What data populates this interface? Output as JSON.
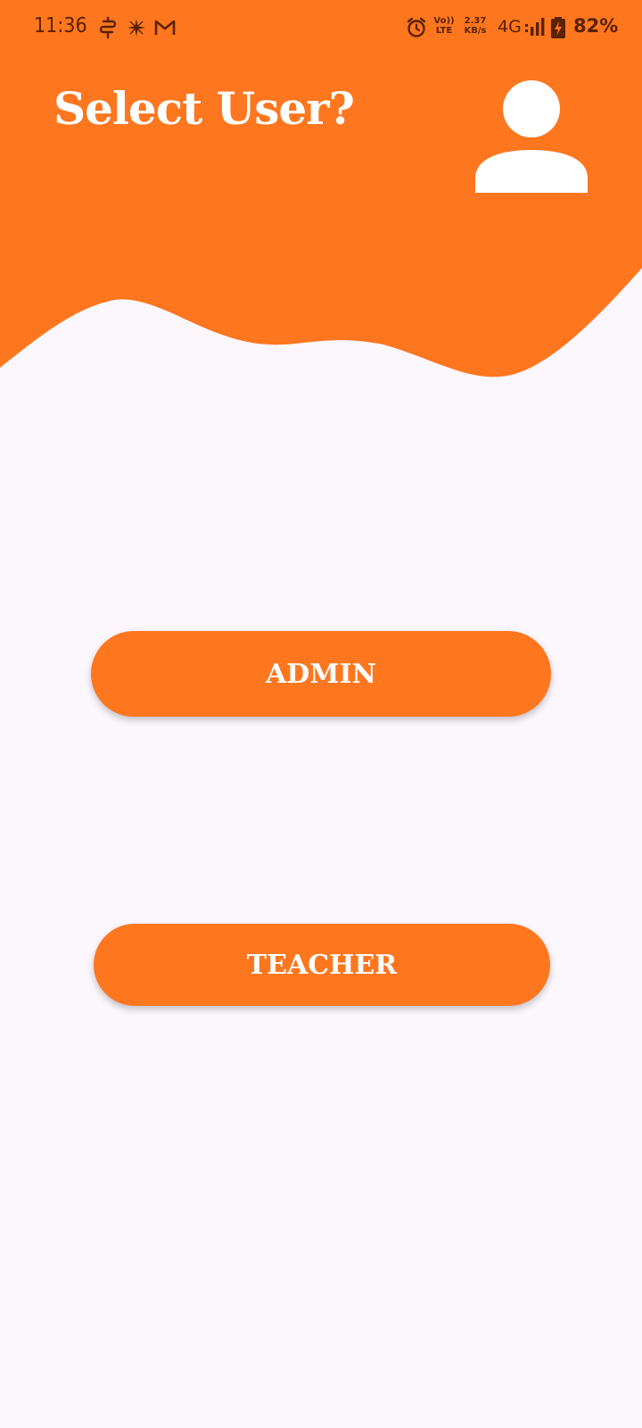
{
  "status_bar": {
    "time": "11:36",
    "left_icons": [
      "sync-icon",
      "sparkle-icon",
      "gmail-icon"
    ],
    "alarm_icon": "alarm-icon",
    "volte_top": "Vo))",
    "volte_bottom": "LTE",
    "speed_value": "2.37",
    "speed_unit": "KB/s",
    "network": "4G",
    "signal_icon": "signal-icon",
    "battery_icon": "battery-charging-icon",
    "battery_percent": "82%"
  },
  "header": {
    "title": "Select User?",
    "icon": "user-icon"
  },
  "buttons": {
    "admin_label": "ADMIN",
    "teacher_label": "TEACHER"
  },
  "colors": {
    "primary": "#fe761e",
    "background": "#fcf6fd",
    "status_text": "#5a2200",
    "on_primary": "#ffffff"
  }
}
